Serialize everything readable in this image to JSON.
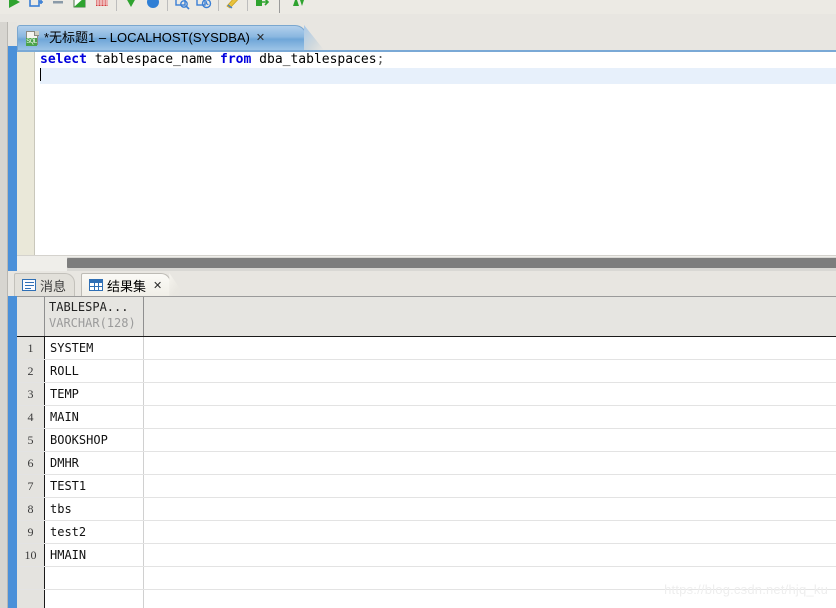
{
  "toolbar": {
    "buttons": [
      {
        "name": "execute-icon",
        "glyph": "▶",
        "color": "#2fa32f"
      },
      {
        "name": "execute-step-icon",
        "glyph": "▣",
        "color": "#3a7fd5"
      },
      {
        "name": "stop-icon",
        "glyph": "▬",
        "color": "#8a9aa8"
      },
      {
        "name": "commit-icon",
        "glyph": "◪",
        "color": "#2fa32f"
      },
      {
        "name": "rollback-icon",
        "glyph": "▩",
        "color": "#d03b3b"
      },
      {
        "name": "previous-result-icon",
        "glyph": "▼",
        "color": "#2fa32f"
      },
      {
        "name": "next-result-icon",
        "glyph": "●",
        "color": "#2f7fd5"
      },
      {
        "name": "explain-plan-icon",
        "glyph": "⌕",
        "color": "#3a7fd5"
      },
      {
        "name": "query-history-icon",
        "glyph": "◷",
        "color": "#3a7fd5"
      },
      {
        "name": "format-sql-icon",
        "glyph": "✎",
        "color": "#e0b020"
      },
      {
        "name": "export-result-icon",
        "glyph": "➜",
        "color": "#2fa32f"
      },
      {
        "name": "sync-icon",
        "glyph": "⇅",
        "color": "#2fa32f"
      }
    ]
  },
  "editor": {
    "tab": {
      "title": "*无标题1 – LOCALHOST(SYSDBA)",
      "close_label": "✕",
      "file_icon_label": "SQL"
    },
    "code": {
      "line1": {
        "kw1": "select",
        "mid": " tablespace_name ",
        "kw2": "from",
        "tail": " dba_tablespaces",
        "semicolon": ";"
      },
      "full_text": "select tablespace_name from dba_tablespaces;"
    }
  },
  "results": {
    "tabs": [
      {
        "label": "消息",
        "icon": "messages-icon",
        "active": false,
        "closable": false
      },
      {
        "label": "结果集",
        "icon": "grid-icon",
        "active": true,
        "closable": true,
        "close_label": "✕"
      }
    ],
    "grid": {
      "columns": [
        {
          "name": "TABLESPA...",
          "type": "VARCHAR(128)"
        }
      ],
      "rows": [
        {
          "num": "1",
          "values": [
            "SYSTEM"
          ]
        },
        {
          "num": "2",
          "values": [
            "ROLL"
          ]
        },
        {
          "num": "3",
          "values": [
            "TEMP"
          ]
        },
        {
          "num": "4",
          "values": [
            "MAIN"
          ]
        },
        {
          "num": "5",
          "values": [
            "BOOKSHOP"
          ]
        },
        {
          "num": "6",
          "values": [
            "DMHR"
          ]
        },
        {
          "num": "7",
          "values": [
            "TEST1"
          ]
        },
        {
          "num": "8",
          "values": [
            "tbs"
          ]
        },
        {
          "num": "9",
          "values": [
            "test2"
          ]
        },
        {
          "num": "10",
          "values": [
            "HMAIN"
          ]
        },
        {
          "num": "",
          "values": [
            ""
          ]
        },
        {
          "num": "",
          "values": [
            ""
          ]
        }
      ]
    }
  },
  "watermark": {
    "text": "https://blog.csdn.net/hjq_ku"
  },
  "colors": {
    "accent_blue": "#4a90d9",
    "keyword_blue": "#0000dd",
    "tab_active": "#8ab7e0",
    "chrome_gray": "#e8e6e1"
  }
}
